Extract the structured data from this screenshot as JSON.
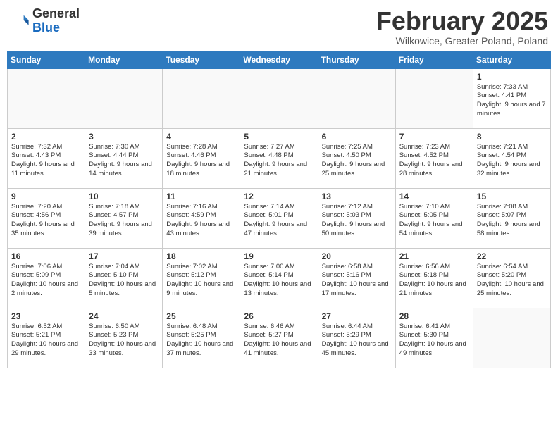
{
  "header": {
    "logo_general": "General",
    "logo_blue": "Blue",
    "month_title": "February 2025",
    "location": "Wilkowice, Greater Poland, Poland"
  },
  "weekdays": [
    "Sunday",
    "Monday",
    "Tuesday",
    "Wednesday",
    "Thursday",
    "Friday",
    "Saturday"
  ],
  "weeks": [
    [
      {
        "day": "",
        "info": ""
      },
      {
        "day": "",
        "info": ""
      },
      {
        "day": "",
        "info": ""
      },
      {
        "day": "",
        "info": ""
      },
      {
        "day": "",
        "info": ""
      },
      {
        "day": "",
        "info": ""
      },
      {
        "day": "1",
        "info": "Sunrise: 7:33 AM\nSunset: 4:41 PM\nDaylight: 9 hours and 7 minutes."
      }
    ],
    [
      {
        "day": "2",
        "info": "Sunrise: 7:32 AM\nSunset: 4:43 PM\nDaylight: 9 hours and 11 minutes."
      },
      {
        "day": "3",
        "info": "Sunrise: 7:30 AM\nSunset: 4:44 PM\nDaylight: 9 hours and 14 minutes."
      },
      {
        "day": "4",
        "info": "Sunrise: 7:28 AM\nSunset: 4:46 PM\nDaylight: 9 hours and 18 minutes."
      },
      {
        "day": "5",
        "info": "Sunrise: 7:27 AM\nSunset: 4:48 PM\nDaylight: 9 hours and 21 minutes."
      },
      {
        "day": "6",
        "info": "Sunrise: 7:25 AM\nSunset: 4:50 PM\nDaylight: 9 hours and 25 minutes."
      },
      {
        "day": "7",
        "info": "Sunrise: 7:23 AM\nSunset: 4:52 PM\nDaylight: 9 hours and 28 minutes."
      },
      {
        "day": "8",
        "info": "Sunrise: 7:21 AM\nSunset: 4:54 PM\nDaylight: 9 hours and 32 minutes."
      }
    ],
    [
      {
        "day": "9",
        "info": "Sunrise: 7:20 AM\nSunset: 4:56 PM\nDaylight: 9 hours and 35 minutes."
      },
      {
        "day": "10",
        "info": "Sunrise: 7:18 AM\nSunset: 4:57 PM\nDaylight: 9 hours and 39 minutes."
      },
      {
        "day": "11",
        "info": "Sunrise: 7:16 AM\nSunset: 4:59 PM\nDaylight: 9 hours and 43 minutes."
      },
      {
        "day": "12",
        "info": "Sunrise: 7:14 AM\nSunset: 5:01 PM\nDaylight: 9 hours and 47 minutes."
      },
      {
        "day": "13",
        "info": "Sunrise: 7:12 AM\nSunset: 5:03 PM\nDaylight: 9 hours and 50 minutes."
      },
      {
        "day": "14",
        "info": "Sunrise: 7:10 AM\nSunset: 5:05 PM\nDaylight: 9 hours and 54 minutes."
      },
      {
        "day": "15",
        "info": "Sunrise: 7:08 AM\nSunset: 5:07 PM\nDaylight: 9 hours and 58 minutes."
      }
    ],
    [
      {
        "day": "16",
        "info": "Sunrise: 7:06 AM\nSunset: 5:09 PM\nDaylight: 10 hours and 2 minutes."
      },
      {
        "day": "17",
        "info": "Sunrise: 7:04 AM\nSunset: 5:10 PM\nDaylight: 10 hours and 5 minutes."
      },
      {
        "day": "18",
        "info": "Sunrise: 7:02 AM\nSunset: 5:12 PM\nDaylight: 10 hours and 9 minutes."
      },
      {
        "day": "19",
        "info": "Sunrise: 7:00 AM\nSunset: 5:14 PM\nDaylight: 10 hours and 13 minutes."
      },
      {
        "day": "20",
        "info": "Sunrise: 6:58 AM\nSunset: 5:16 PM\nDaylight: 10 hours and 17 minutes."
      },
      {
        "day": "21",
        "info": "Sunrise: 6:56 AM\nSunset: 5:18 PM\nDaylight: 10 hours and 21 minutes."
      },
      {
        "day": "22",
        "info": "Sunrise: 6:54 AM\nSunset: 5:20 PM\nDaylight: 10 hours and 25 minutes."
      }
    ],
    [
      {
        "day": "23",
        "info": "Sunrise: 6:52 AM\nSunset: 5:21 PM\nDaylight: 10 hours and 29 minutes."
      },
      {
        "day": "24",
        "info": "Sunrise: 6:50 AM\nSunset: 5:23 PM\nDaylight: 10 hours and 33 minutes."
      },
      {
        "day": "25",
        "info": "Sunrise: 6:48 AM\nSunset: 5:25 PM\nDaylight: 10 hours and 37 minutes."
      },
      {
        "day": "26",
        "info": "Sunrise: 6:46 AM\nSunset: 5:27 PM\nDaylight: 10 hours and 41 minutes."
      },
      {
        "day": "27",
        "info": "Sunrise: 6:44 AM\nSunset: 5:29 PM\nDaylight: 10 hours and 45 minutes."
      },
      {
        "day": "28",
        "info": "Sunrise: 6:41 AM\nSunset: 5:30 PM\nDaylight: 10 hours and 49 minutes."
      },
      {
        "day": "",
        "info": ""
      }
    ]
  ]
}
